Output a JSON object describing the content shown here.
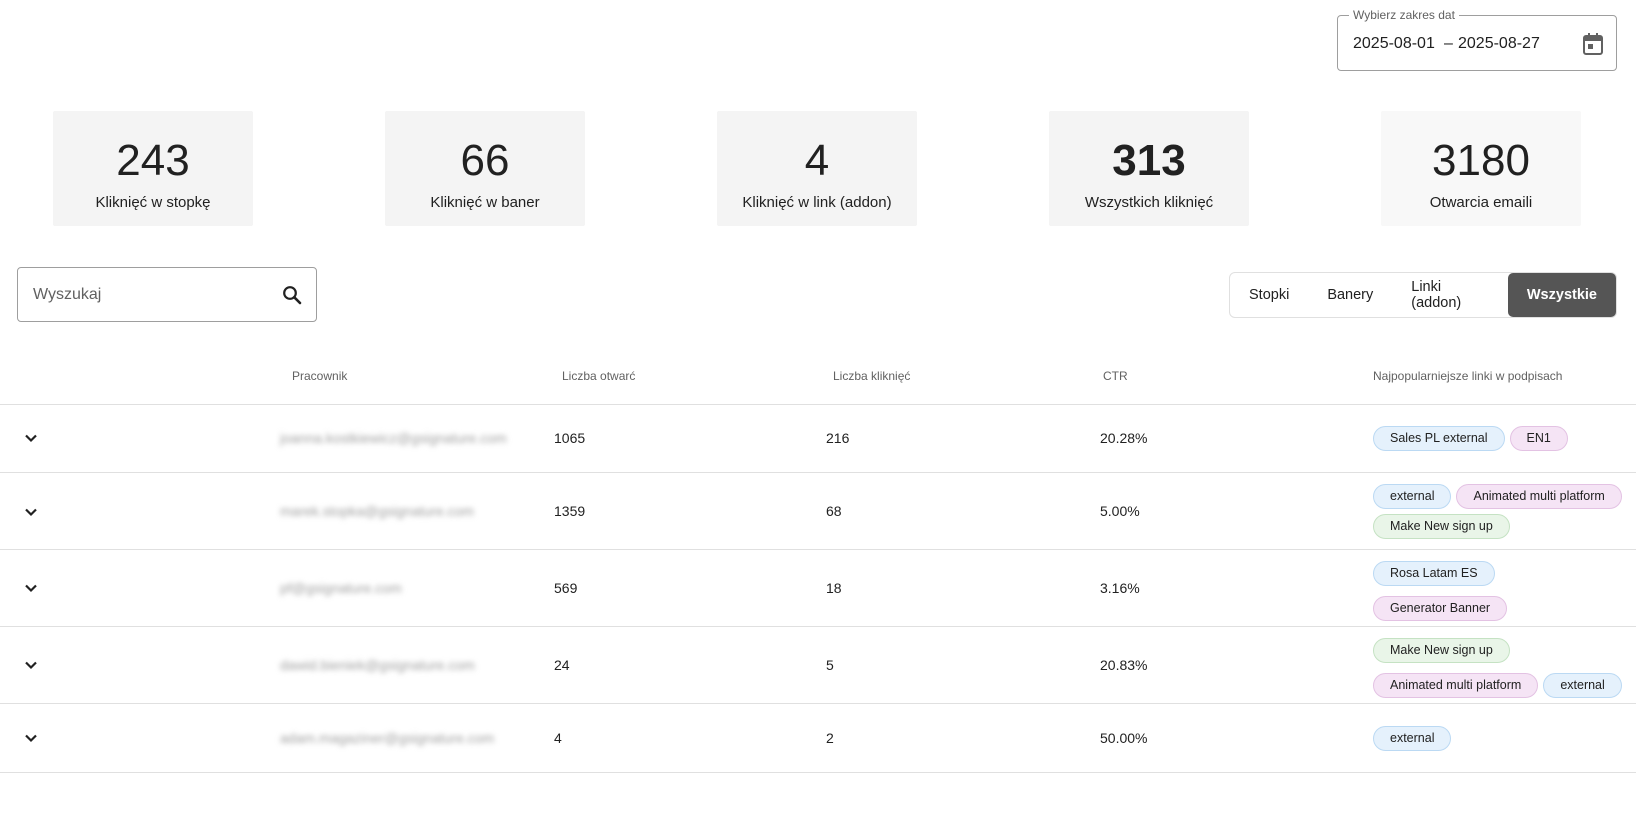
{
  "date_range": {
    "label": "Wybierz zakres dat",
    "start": "2025-08-01",
    "separator": "–",
    "end": "2025-08-27"
  },
  "stats": [
    {
      "value": "243",
      "label": "Kliknięć w stopkę"
    },
    {
      "value": "66",
      "label": "Kliknięć w baner"
    },
    {
      "value": "4",
      "label": "Kliknięć w link (addon)"
    },
    {
      "value": "313",
      "label": "Wszystkich kliknięć"
    },
    {
      "value": "3180",
      "label": "Otwarcia emaili"
    }
  ],
  "search": {
    "placeholder": "Wyszukaj"
  },
  "filters": [
    "Stopki",
    "Banery",
    "Linki (addon)",
    "Wszystkie"
  ],
  "active_filter": "Wszystkie",
  "table": {
    "headers": [
      "Pracownik",
      "Liczba otwarć",
      "Liczba kliknięć",
      "CTR",
      "Najpopularniejsze linki w podpisach"
    ],
    "rows": [
      {
        "email": "joanna.kostkiewicz@gsignature.com",
        "opens": "1065",
        "clicks": "216",
        "ctr": "20.28%",
        "chips": [
          {
            "text": "Sales PL external",
            "color": "blue"
          },
          {
            "text": "EN1",
            "color": "pink"
          }
        ]
      },
      {
        "email": "marek.stopka@gsignature.com",
        "opens": "1359",
        "clicks": "68",
        "ctr": "5.00%",
        "chips": [
          {
            "text": "external",
            "color": "blue"
          },
          {
            "text": "Animated multi platform",
            "color": "pink"
          },
          {
            "text": "Make New sign up",
            "color": "green"
          }
        ]
      },
      {
        "email": "pf@gsignature.com",
        "opens": "569",
        "clicks": "18",
        "ctr": "3.16%",
        "chips": [
          {
            "text": "Rosa Latam ES",
            "color": "blue"
          },
          {
            "text": "Generator Banner",
            "color": "pink"
          }
        ]
      },
      {
        "email": "dawid.bieniek@gsignature.com",
        "opens": "24",
        "clicks": "5",
        "ctr": "20.83%",
        "chips": [
          {
            "text": "Make New sign up",
            "color": "green"
          },
          {
            "text": "Animated multi platform",
            "color": "pink"
          },
          {
            "text": "external",
            "color": "blue"
          }
        ]
      },
      {
        "email": "adam.magaziner@gsignature.com",
        "opens": "4",
        "clicks": "2",
        "ctr": "50.00%",
        "chips": [
          {
            "text": "external",
            "color": "blue"
          }
        ]
      }
    ]
  }
}
